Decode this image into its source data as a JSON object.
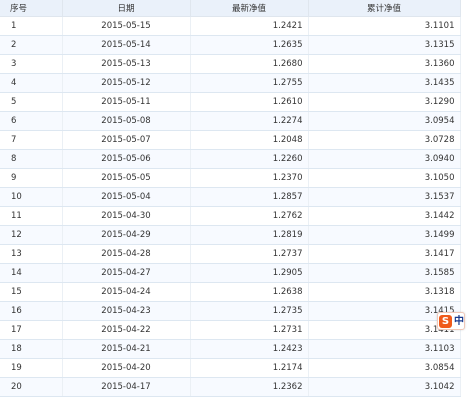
{
  "table": {
    "headers": [
      "序号",
      "日期",
      "最新净值",
      "累计净值"
    ],
    "rows": [
      [
        "1",
        "2015-05-15",
        "1.2421",
        "3.1101"
      ],
      [
        "2",
        "2015-05-14",
        "1.2635",
        "3.1315"
      ],
      [
        "3",
        "2015-05-13",
        "1.2680",
        "3.1360"
      ],
      [
        "4",
        "2015-05-12",
        "1.2755",
        "3.1435"
      ],
      [
        "5",
        "2015-05-11",
        "1.2610",
        "3.1290"
      ],
      [
        "6",
        "2015-05-08",
        "1.2274",
        "3.0954"
      ],
      [
        "7",
        "2015-05-07",
        "1.2048",
        "3.0728"
      ],
      [
        "8",
        "2015-05-06",
        "1.2260",
        "3.0940"
      ],
      [
        "9",
        "2015-05-05",
        "1.2370",
        "3.1050"
      ],
      [
        "10",
        "2015-05-04",
        "1.2857",
        "3.1537"
      ],
      [
        "11",
        "2015-04-30",
        "1.2762",
        "3.1442"
      ],
      [
        "12",
        "2015-04-29",
        "1.2819",
        "3.1499"
      ],
      [
        "13",
        "2015-04-28",
        "1.2737",
        "3.1417"
      ],
      [
        "14",
        "2015-04-27",
        "1.2905",
        "3.1585"
      ],
      [
        "15",
        "2015-04-24",
        "1.2638",
        "3.1318"
      ],
      [
        "16",
        "2015-04-23",
        "1.2735",
        "3.1415"
      ],
      [
        "17",
        "2015-04-22",
        "1.2731",
        "3.1411"
      ],
      [
        "18",
        "2015-04-21",
        "1.2423",
        "3.1103"
      ],
      [
        "19",
        "2015-04-20",
        "1.2174",
        "3.0854"
      ],
      [
        "20",
        "2015-04-17",
        "1.2362",
        "3.1042"
      ]
    ]
  },
  "ime_toolbar": {
    "logo_letter": "S",
    "mode_label": "中",
    "icon": "sogou-ime-icon"
  }
}
